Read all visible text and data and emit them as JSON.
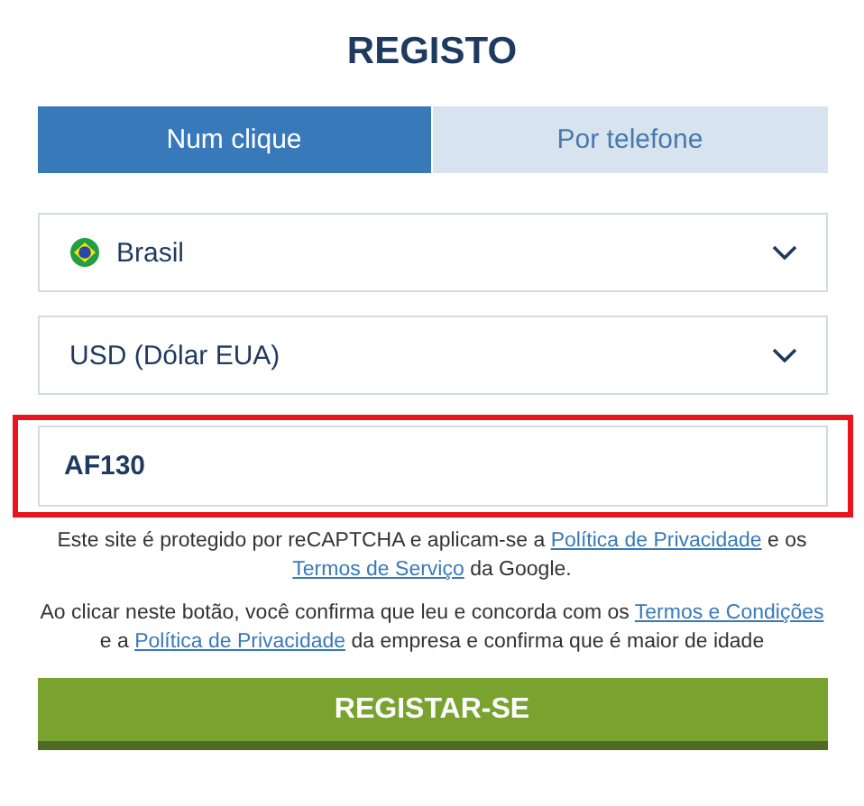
{
  "title": "REGISTO",
  "tabs": [
    {
      "label": "Num clique",
      "selected": true
    },
    {
      "label": "Por telefone",
      "selected": false
    }
  ],
  "selects": [
    {
      "kind": "country",
      "value": "Brasil"
    },
    {
      "kind": "currency",
      "value": "USD (Dólar EUA)"
    }
  ],
  "promo_field": {
    "value": "AF130",
    "highlighted": true
  },
  "notices": [
    [
      {
        "kind": "text",
        "text": "Este site é protegido por reCAPTCHA e aplicam-se a "
      },
      {
        "kind": "link",
        "text": "Política de Privacidade"
      },
      {
        "kind": "text",
        "text": " e os "
      },
      {
        "kind": "link",
        "text": "Termos de Serviço"
      },
      {
        "kind": "text",
        "text": " da Google."
      }
    ],
    [
      {
        "kind": "text",
        "text": "Ao clicar neste botão, você confirma que leu e concorda com os "
      },
      {
        "kind": "link",
        "text": "Termos e Condições"
      },
      {
        "kind": "text",
        "text": " e a "
      },
      {
        "kind": "link",
        "text": "Política de Privacidade"
      },
      {
        "kind": "text",
        "text": " da empresa e confirma que é maior de idade"
      }
    ]
  ],
  "submit_button": "REGISTAR-SE"
}
